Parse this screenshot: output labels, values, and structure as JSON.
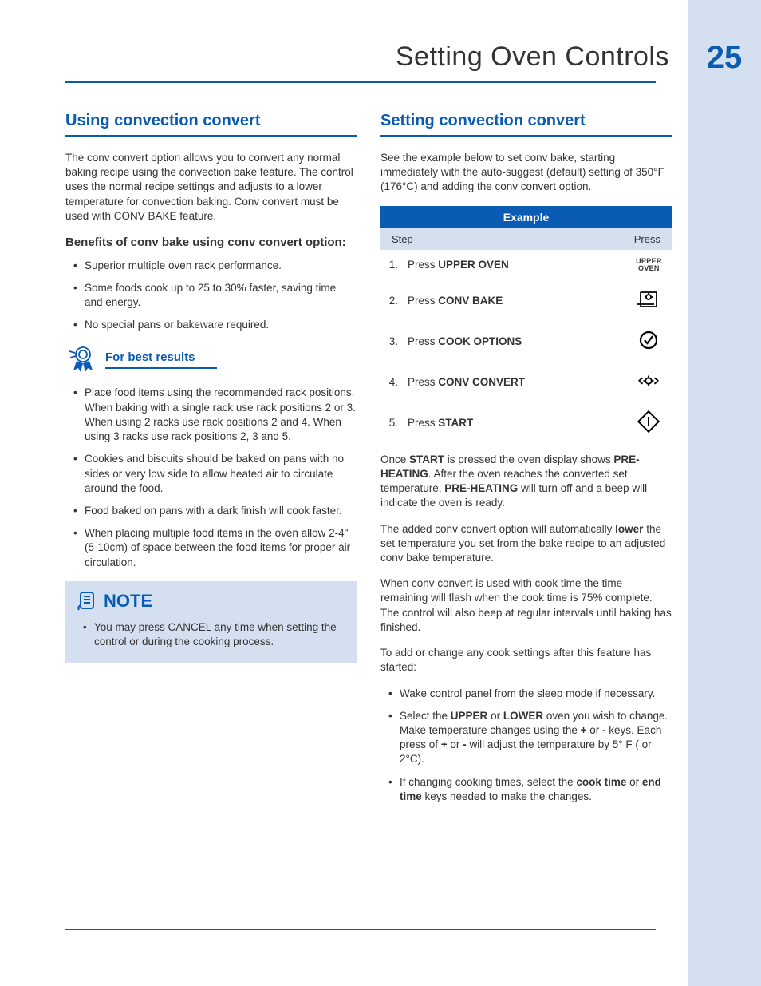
{
  "page": {
    "title": "Setting Oven Controls",
    "number": "25"
  },
  "left": {
    "heading": "Using convection convert",
    "intro": "The  conv convert option allows you to convert any normal baking recipe using the convection bake feature. The control uses the normal recipe settings and adjusts to a lower temperature for convection baking. Conv convert must be used with CONV BAKE feature.",
    "benefits_heading": "Benefits of conv bake using conv convert option:",
    "benefits": [
      "Superior multiple oven rack performance.",
      "Some foods cook up to 25 to 30% faster, saving time and energy.",
      "No special pans or bakeware required."
    ],
    "best_results_heading": "For best results",
    "best_results": [
      "Place food items using the recommended rack positions. When baking with a single rack use rack positions 2 or 3. When using 2 racks use rack positions  2 and 4. When using 3 racks use rack positions 2, 3 and 5.",
      "Cookies and biscuits should be baked on pans with no sides or very low side to allow heated air to circulate around the food.",
      "Food baked on pans with a dark finish will cook faster.",
      "When placing multiple food items in the oven allow 2-4\" (5-10cm) of space between the food items for proper air circulation."
    ],
    "note_heading": "NOTE",
    "note_items": [
      "You may press CANCEL any time when setting the control or during the cooking process."
    ]
  },
  "right": {
    "heading": "Setting convection convert",
    "intro": "See the example below to set conv bake, starting immediately with the auto-suggest (default) setting of 350°F (176°C) and adding the conv convert option.",
    "example_header": "Example",
    "col_step": "Step",
    "col_press": "Press",
    "steps": [
      {
        "num": "1.",
        "prefix": "Press ",
        "bold": "UPPER OVEN",
        "icon": "upper-oven"
      },
      {
        "num": "2.",
        "prefix": "Press ",
        "bold": "CONV BAKE",
        "icon": "conv-bake"
      },
      {
        "num": "3.",
        "prefix": "Press ",
        "bold": "COOK OPTIONS",
        "icon": "cook-options"
      },
      {
        "num": "4.",
        "prefix": "Press ",
        "bold": "CONV CONVERT",
        "icon": "conv-convert"
      },
      {
        "num": "5.",
        "prefix": "Press ",
        "bold": "START",
        "icon": "start"
      }
    ],
    "after1_a": "Once ",
    "after1_b": "START",
    "after1_c": " is pressed the oven display shows ",
    "after1_d": "PRE-HEATING",
    "after1_e": ". After the oven reaches the converted set temperature, ",
    "after1_f": "PRE-HEATING",
    "after1_g": " will turn off and a beep will indicate the oven is ready.",
    "after2_a": "The added conv convert option will automatically ",
    "after2_b": "lower",
    "after2_c": " the set temperature you set from the bake recipe to an adjusted conv bake temperature.",
    "after3": "When conv convert is used with cook time the time remaining will flash when the cook time is 75% complete. The control will also beep at regular intervals until baking has finished.",
    "after4": "To add or change any cook settings after this feature has started:",
    "change_items": {
      "i0": "Wake control panel from the sleep mode if necessary.",
      "i1_a": "Select the ",
      "i1_b": "UPPER",
      "i1_c": " or ",
      "i1_d": "LOWER",
      "i1_e": " oven you wish to change. Make temperature changes using the ",
      "i1_f": "+",
      "i1_g": " or ",
      "i1_h": "-",
      "i1_i": " keys. Each press of ",
      "i1_j": "+",
      "i1_k": " or ",
      "i1_l": "-",
      "i1_m": " will adjust the temperature by 5° F ( or 2°C).",
      "i2_a": "If changing cooking times, select the ",
      "i2_b": "cook time",
      "i2_c": " or ",
      "i2_d": "end time",
      "i2_e": " keys needed to make the changes."
    },
    "upper_oven_label1": "UPPER",
    "upper_oven_label2": "OVEN"
  }
}
